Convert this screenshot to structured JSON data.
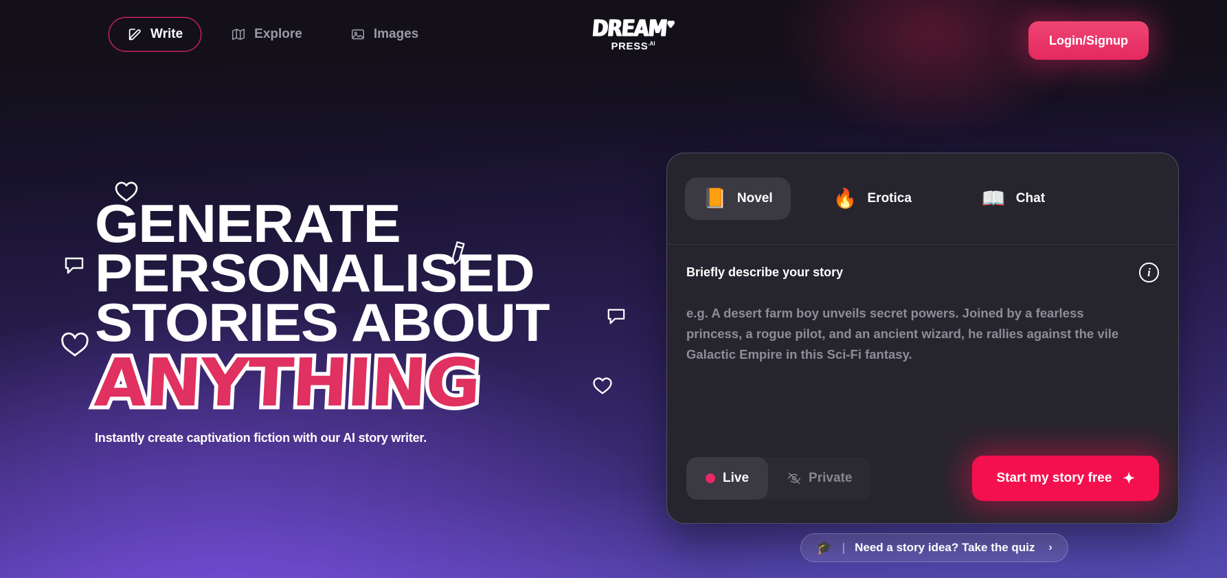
{
  "header": {
    "nav": [
      {
        "label": "Write",
        "icon": "pencil-square-icon",
        "active": true
      },
      {
        "label": "Explore",
        "icon": "map-icon",
        "active": false
      },
      {
        "label": "Images",
        "icon": "image-icon",
        "active": false
      }
    ],
    "logo": {
      "line1": "DREAM",
      "line2": "PRESS",
      "suffix": ".AI",
      "heart": "♥"
    },
    "login_label": "Login/Signup"
  },
  "hero": {
    "headline_lines": [
      "GENERATE",
      "PERSONALISED",
      "STORIES ABOUT"
    ],
    "accent_word": "ANYTHING",
    "subline": "Instantly create captivation fiction with our AI story writer."
  },
  "card": {
    "tabs": [
      {
        "label": "Novel",
        "emoji": "📙",
        "icon": "notebook-icon",
        "active": true
      },
      {
        "label": "Erotica",
        "emoji": "🔥",
        "icon": "fire-icon",
        "active": false
      },
      {
        "label": "Chat",
        "emoji": "📖",
        "icon": "open-book-icon",
        "active": false
      }
    ],
    "prompt_label": "Briefly describe your story",
    "info_glyph": "i",
    "prompt_placeholder": "e.g. A desert farm boy unveils secret powers. Joined by a fearless princess, a rogue pilot, and an ancient wizard, he rallies against the vile Galactic Empire in this Sci-Fi fantasy.",
    "prompt_value": "",
    "visibility": [
      {
        "label": "Live",
        "icon": "live-dot-icon",
        "active": true
      },
      {
        "label": "Private",
        "icon": "eye-off-icon",
        "active": false
      }
    ],
    "cta_label": "Start my story free",
    "cta_sparkle": "✦"
  },
  "quiz": {
    "icon": "graduation-cap-icon",
    "cap_glyph": "🎓",
    "separator": "|",
    "label": "Need a story idea? Take the quiz",
    "chevron": "›"
  },
  "colors": {
    "accent_pink": "#ec2864",
    "cta_red": "#f4104f",
    "card_bg": "#26252d",
    "bg_dark": "#131019",
    "bg_purple": "#5a49b8"
  }
}
